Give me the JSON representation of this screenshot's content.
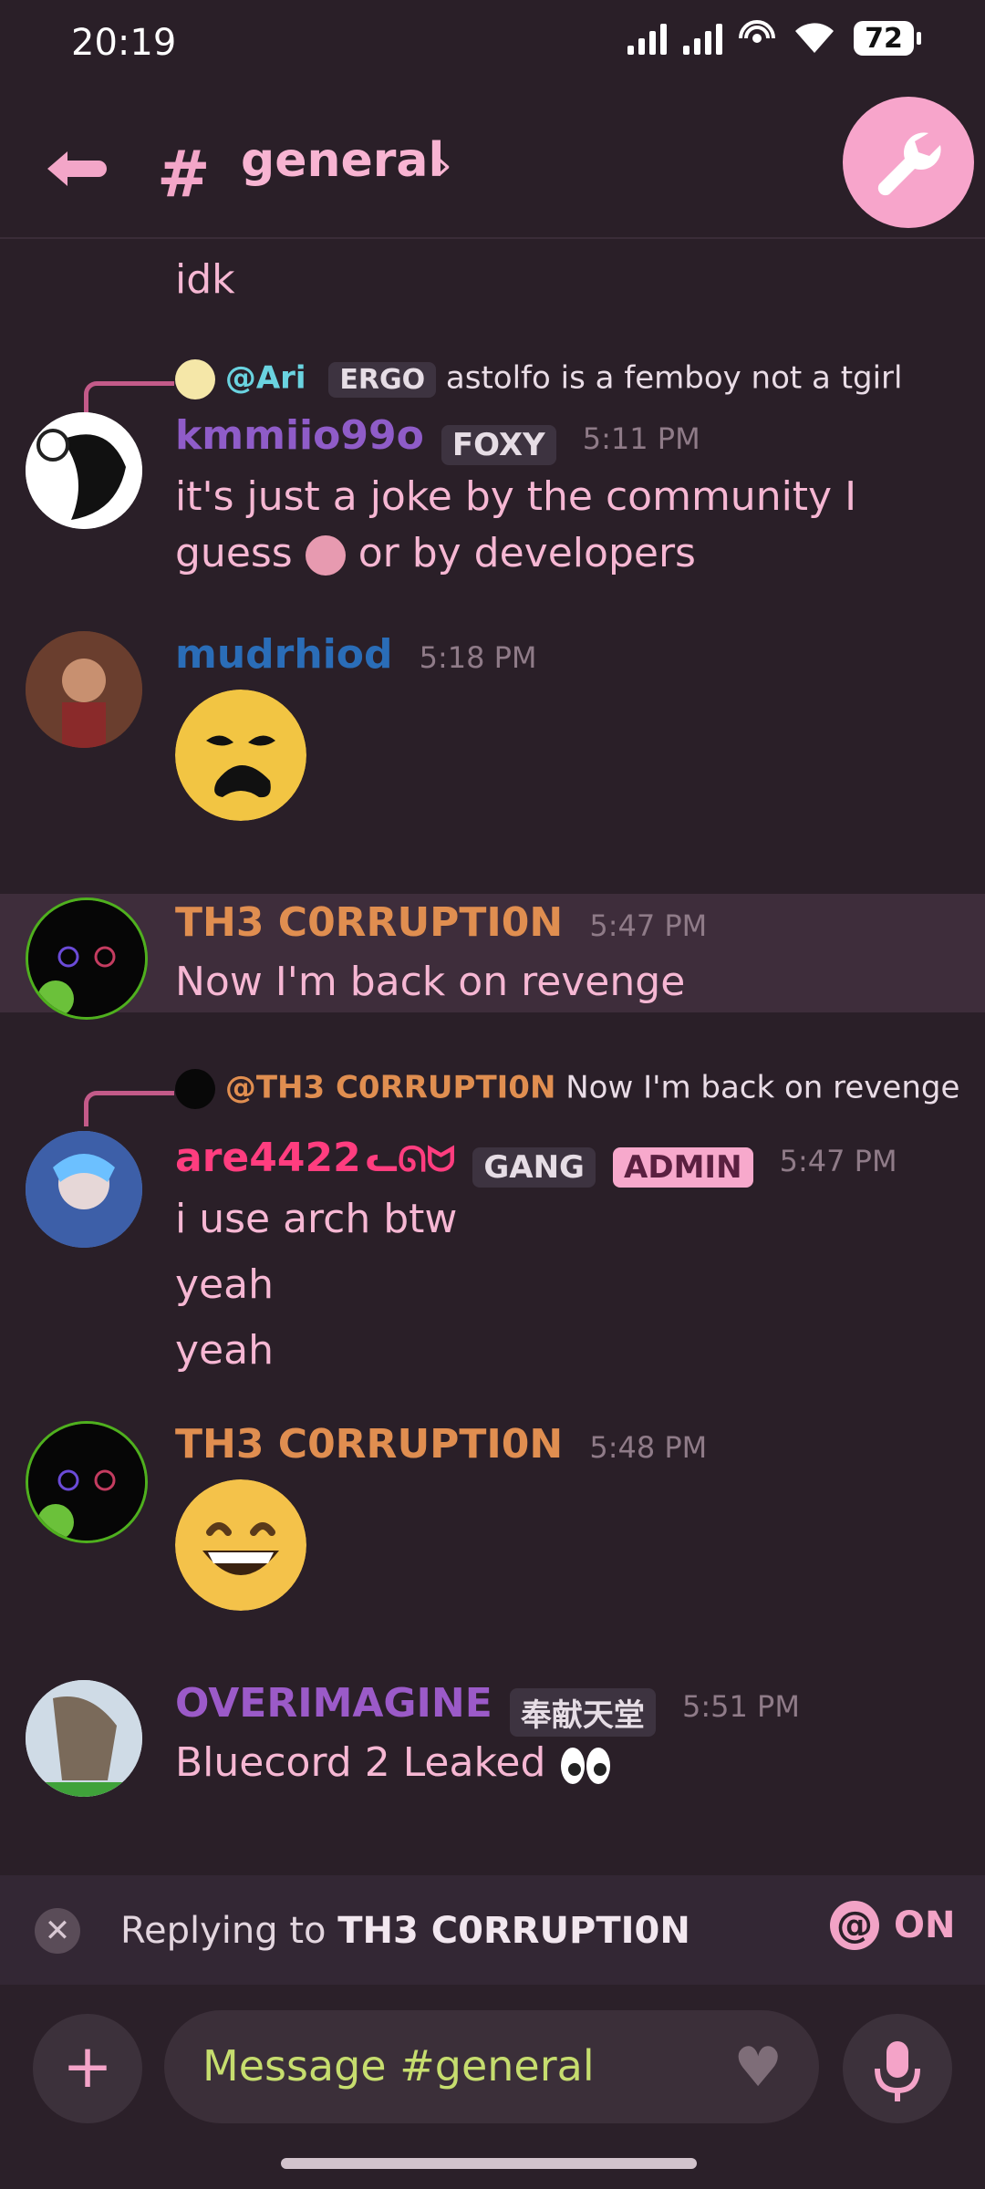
{
  "status": {
    "time": "20:19",
    "battery": "72"
  },
  "header": {
    "channel": "general"
  },
  "messages": {
    "m0": {
      "text": "idk"
    },
    "m1": {
      "reply_user": "@Ari",
      "reply_tag": "ERGO",
      "reply_text": "astolfo is a femboy not a tgirl",
      "author": "kmmiio99o",
      "tag": "FOXY",
      "time": "5:11 PM",
      "line1": "it's just a joke by the community I",
      "line2": "guess",
      "line2b": "or by developers",
      "author_color": "#8f5cc8"
    },
    "m2": {
      "author": "mudrhiod",
      "time": "5:18 PM",
      "author_color": "#2a6db8"
    },
    "m3": {
      "author": "TH3 C0RRUPTI0N",
      "time": "5:47 PM",
      "text": "Now I'm back on revenge",
      "author_color": "#e08e50"
    },
    "m4": {
      "reply_user": "@TH3 C0RRUPTI0N",
      "reply_text": "Now I'm back on revenge",
      "author": "are4422",
      "suffix": "ᓚᘏᗢ",
      "tag": "GANG",
      "role": "ADMIN",
      "time": "5:47 PM",
      "l1": "i use arch btw",
      "l2": "yeah",
      "l3": "yeah",
      "author_color": "#ff3d7f"
    },
    "m5": {
      "author": "TH3 C0RRUPTI0N",
      "time": "5:48 PM",
      "author_color": "#e08e50"
    },
    "m6": {
      "author": "OVERIMAGINE",
      "tag": "奉献天堂",
      "time": "5:51 PM",
      "text": "Bluecord 2 Leaked",
      "author_color": "#9b5ac8"
    }
  },
  "replybar": {
    "prefix": "Replying to ",
    "target": "TH3 C0RRUPTI0N",
    "mention_state": "ON"
  },
  "composer": {
    "placeholder": "Message #general"
  }
}
